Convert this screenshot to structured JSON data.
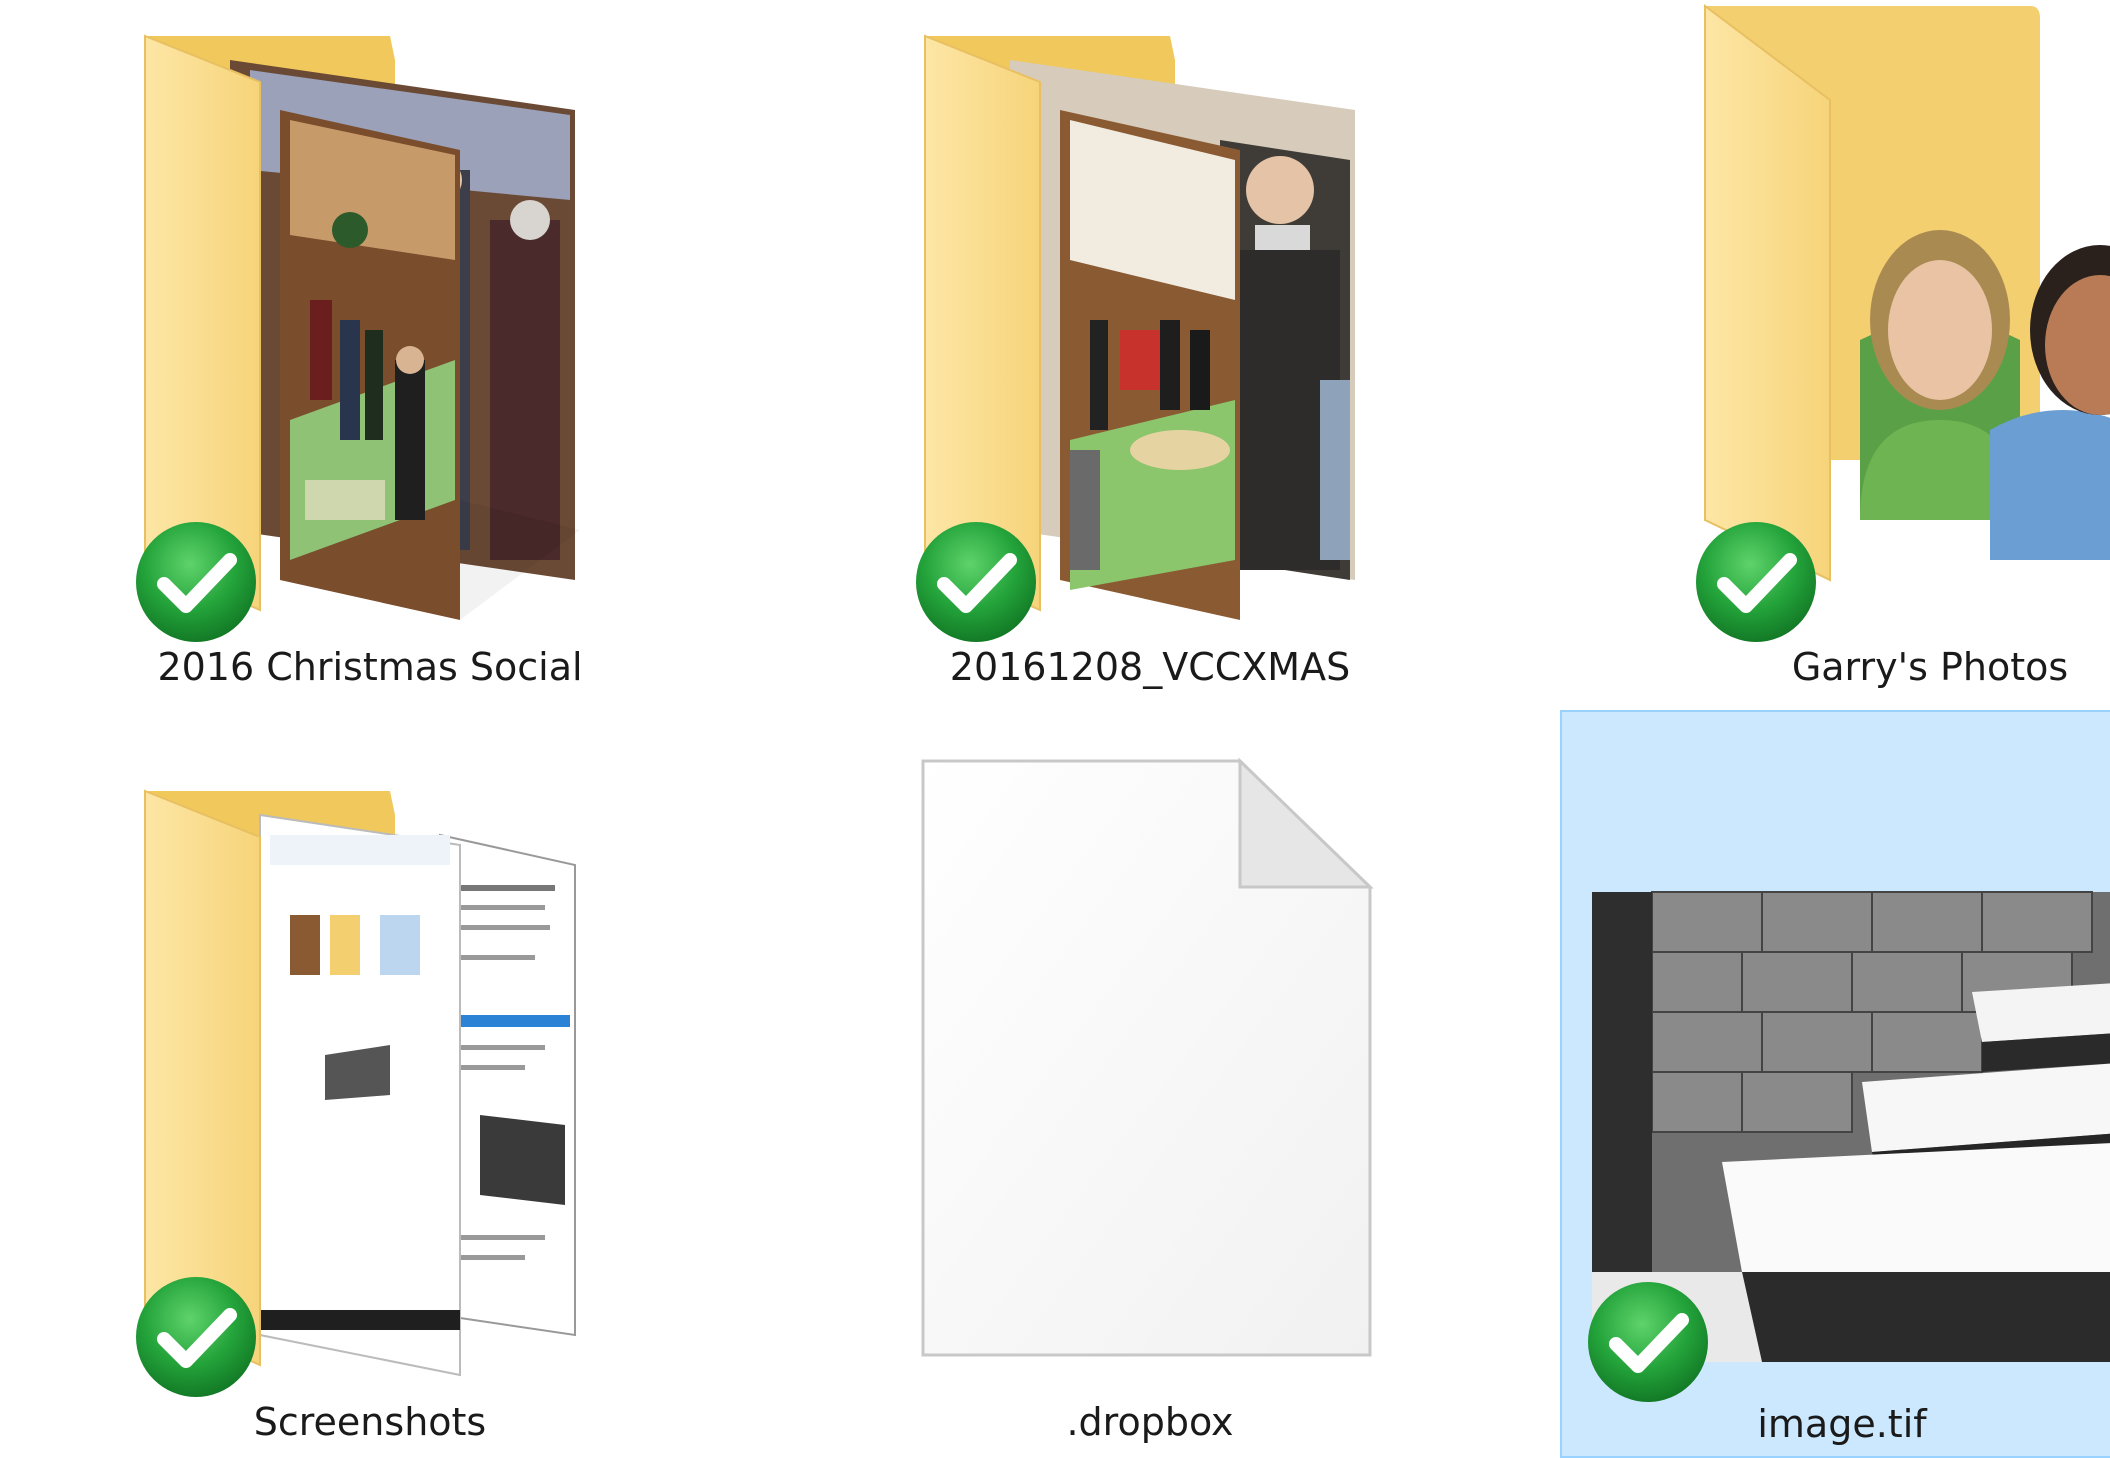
{
  "explorer": {
    "items": [
      {
        "name": "2016 Christmas Social",
        "kind": "folder",
        "sync_status": "synced"
      },
      {
        "name": "20161208_VCCXMAS",
        "kind": "folder",
        "sync_status": "synced"
      },
      {
        "name": "Garry's Photos",
        "kind": "folder",
        "sync_status": "synced"
      },
      {
        "name": "Screenshots",
        "kind": "folder",
        "sync_status": "synced"
      },
      {
        "name": ".dropbox",
        "kind": "file",
        "sync_status": "none"
      },
      {
        "name": "image.tif",
        "kind": "image",
        "sync_status": "synced",
        "selected": true
      }
    ]
  },
  "colors": {
    "folder_back": "#f0c85c",
    "folder_front": "#fbdc8c",
    "selection_fill": "#cce8ff",
    "selection_border": "#99d1ff",
    "check_green": "#23a23a"
  },
  "icons": {
    "sync": "green-checkmark-icon",
    "folder": "folder-icon",
    "file": "blank-file-icon"
  }
}
